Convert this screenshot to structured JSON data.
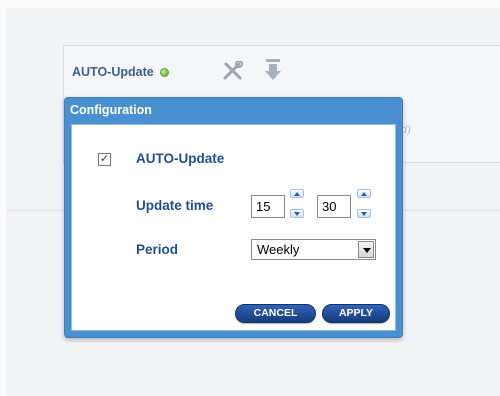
{
  "background_panel": {
    "title": "AUTO-Update",
    "status": "green",
    "ghost_text": "d)",
    "icons": [
      "tools-icon",
      "download-icon"
    ]
  },
  "dialog": {
    "title": "Configuration",
    "autoupdate_label": "AUTO-Update",
    "autoupdate_checked": true,
    "checkmark": "✓",
    "update_time_label": "Update time",
    "hour_value": "15",
    "minute_value": "30",
    "period_label": "Period",
    "period_value": "Weekly",
    "cancel_label": "CANCEL",
    "apply_label": "APPLY"
  },
  "colors": {
    "dialog_blue": "#4a90d0",
    "label_blue": "#1f4f94",
    "button_navy": "#173c7c",
    "status_green": "#6bbd3c"
  }
}
